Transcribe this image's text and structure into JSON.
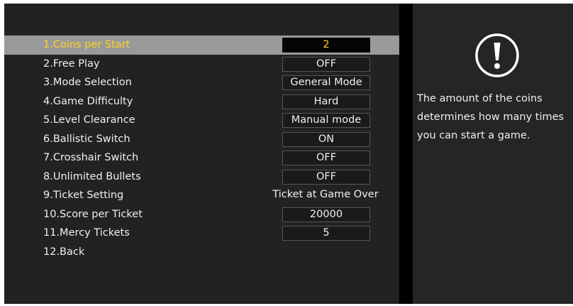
{
  "menu": {
    "items": [
      {
        "label": "1.Coins per Start",
        "value": "2",
        "selected": true
      },
      {
        "label": "2.Free Play",
        "value": "OFF"
      },
      {
        "label": "3.Mode Selection",
        "value": "General Mode"
      },
      {
        "label": "4.Game Difficulty",
        "value": "Hard"
      },
      {
        "label": "5.Level Clearance",
        "value": "Manual mode"
      },
      {
        "label": "6.Ballistic Switch",
        "value": "ON"
      },
      {
        "label": "7.Crosshair Switch",
        "value": "OFF"
      },
      {
        "label": "8.Unlimited Bullets",
        "value": "OFF"
      },
      {
        "label": "9.Ticket Setting",
        "value": "Ticket at Game Over"
      },
      {
        "label": "10.Score per Ticket",
        "value": "20000"
      },
      {
        "label": "11.Mercy Tickets",
        "value": "5"
      },
      {
        "label": "12.Back",
        "value": ""
      }
    ]
  },
  "info": {
    "icon": "exclamation-circle-icon",
    "text": "The amount of the coins determines how many times you can start a game."
  },
  "colors": {
    "highlight_text": "#ffd21c",
    "selection_bar": "#9a9a9a",
    "panel_background": "#222222"
  }
}
